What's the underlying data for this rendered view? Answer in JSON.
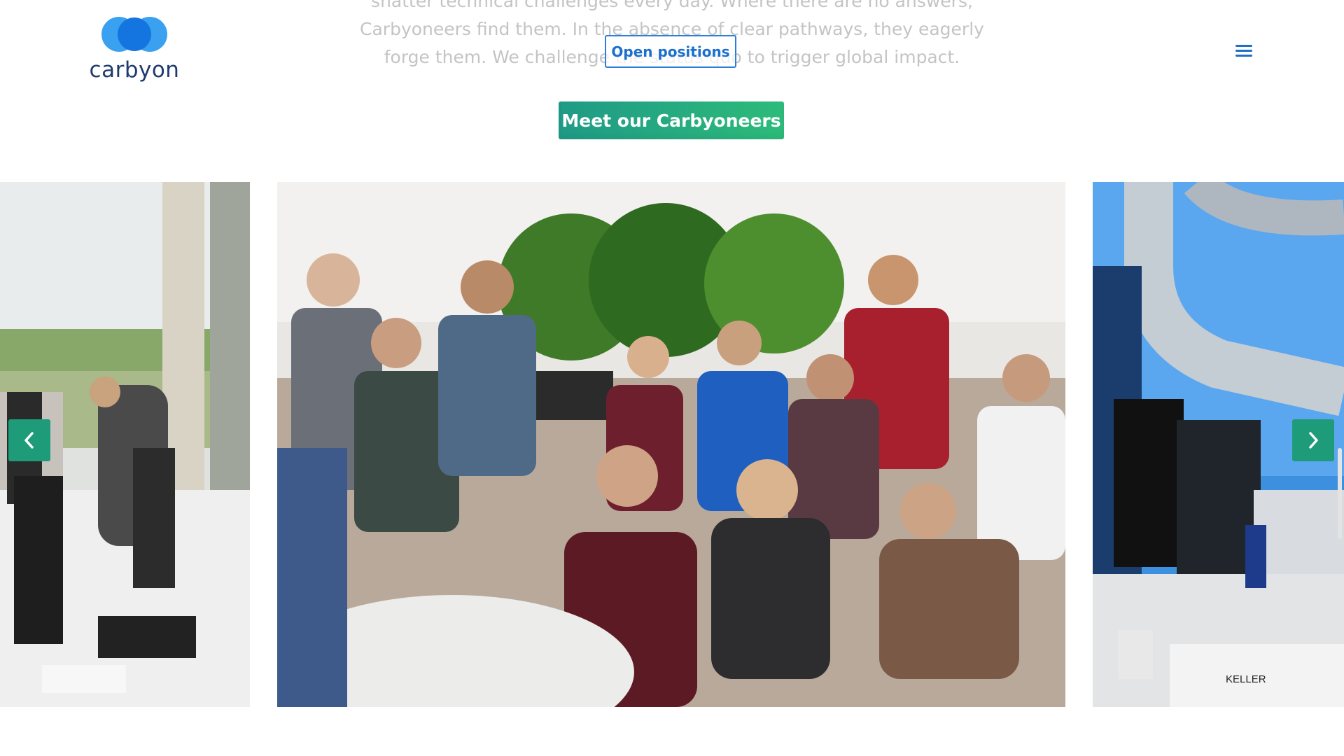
{
  "brand": {
    "name": "carbyon",
    "icon": "carbyon-logo-circles"
  },
  "header": {
    "menu_icon": "hamburger-menu-icon",
    "open_positions_label": "Open positions"
  },
  "intro": {
    "line1": "shatter technical challenges every day. Where there are no answers,",
    "line2": "Carbyoneers find them. In the absence of clear pathways, they eagerly",
    "line3": "forge them. We challenge the status quo to trigger global impact."
  },
  "cta": {
    "label": "Meet our Carbyoneers"
  },
  "carousel": {
    "prev_icon": "chevron-left-icon",
    "next_icon": "chevron-right-icon",
    "badge_text": "KELLER"
  },
  "colors": {
    "accent_blue": "#1a6fcf",
    "logo_navy": "#1f3a6e",
    "cta_green_start": "#1f9a86",
    "cta_green_end": "#2dbb7a",
    "arrow_green": "#1e9c7a",
    "intro_text": "#c4c4c4"
  }
}
